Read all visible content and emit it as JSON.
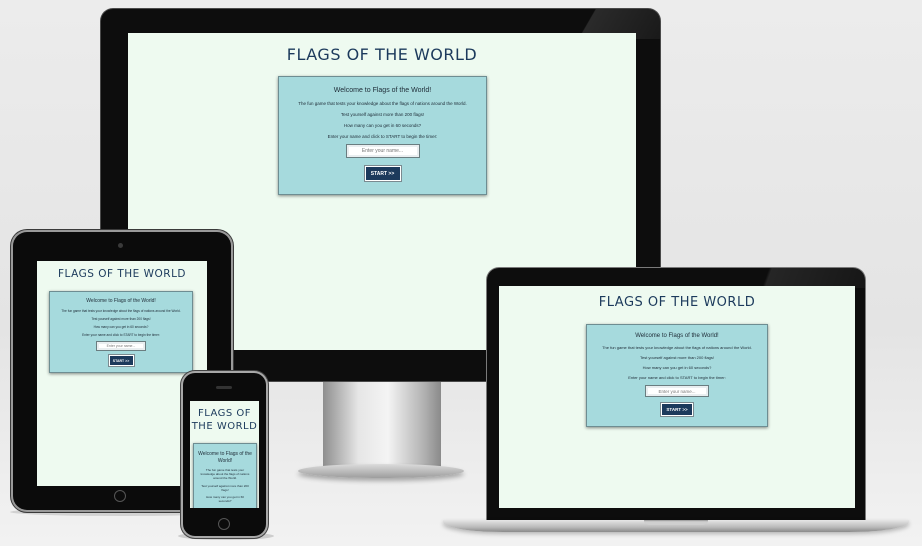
{
  "site": {
    "title": "FLAGS OF THE WORLD",
    "title_line1": "FLAGS OF",
    "title_line2": "THE WORLD"
  },
  "card": {
    "heading": "Welcome to Flags of the World!",
    "intro": "The fun game that tests your knowledge about the flags of nations around the World.",
    "intro_wrap_a": "The fun game that tests your",
    "intro_wrap_b": "knowledge about the flags of nations",
    "intro_wrap_c": "around the World.",
    "test": "Test yourself against more than 200 flags!",
    "test_wrap_a": "Test yourself against more than 200",
    "test_wrap_b": "flags!",
    "how_many": "How many can you get in 60 seconds?",
    "how_many_wrap_a": "How many can you get in 60",
    "how_many_wrap_b": "seconds?",
    "instruction": "Enter your name and click to START to begin the timer:",
    "name_placeholder": "Enter your name...",
    "start_label": "START >>"
  },
  "colors": {
    "page_bg": "#eefaf0",
    "card_bg": "#a6dadd",
    "accent": "#1c3a5c"
  }
}
